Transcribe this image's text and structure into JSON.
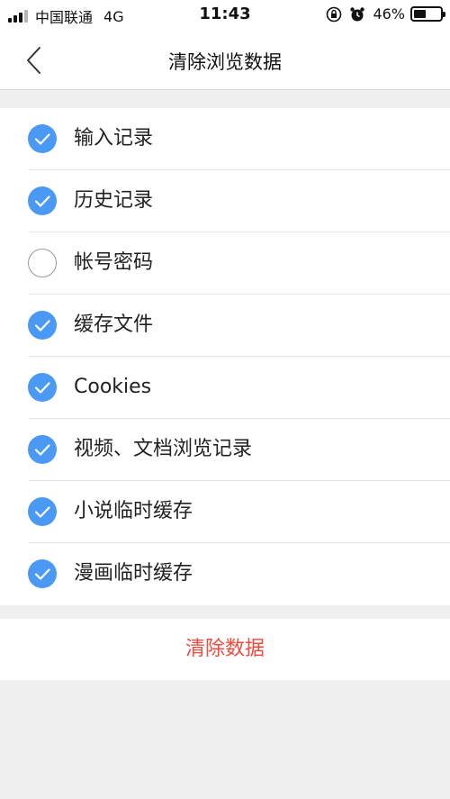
{
  "status_bar": {
    "carrier": "中国联通",
    "network": "4G",
    "time": "11:43",
    "battery_percent_text": "46%",
    "battery_level": 0.46
  },
  "nav": {
    "title": "清除浏览数据",
    "back_icon": "chevron-left-icon"
  },
  "options": [
    {
      "label": "输入记录",
      "checked": true
    },
    {
      "label": "历史记录",
      "checked": true
    },
    {
      "label": "帐号密码",
      "checked": false
    },
    {
      "label": "缓存文件",
      "checked": true
    },
    {
      "label": "Cookies",
      "checked": true
    },
    {
      "label": "视频、文档浏览记录",
      "checked": true
    },
    {
      "label": "小说临时缓存",
      "checked": true
    },
    {
      "label": "漫画临时缓存",
      "checked": true
    }
  ],
  "clear_button": {
    "label": "清除数据",
    "color": "#f04a3c"
  },
  "colors": {
    "accent": "#4a9af5",
    "background": "#f0f0f0"
  }
}
